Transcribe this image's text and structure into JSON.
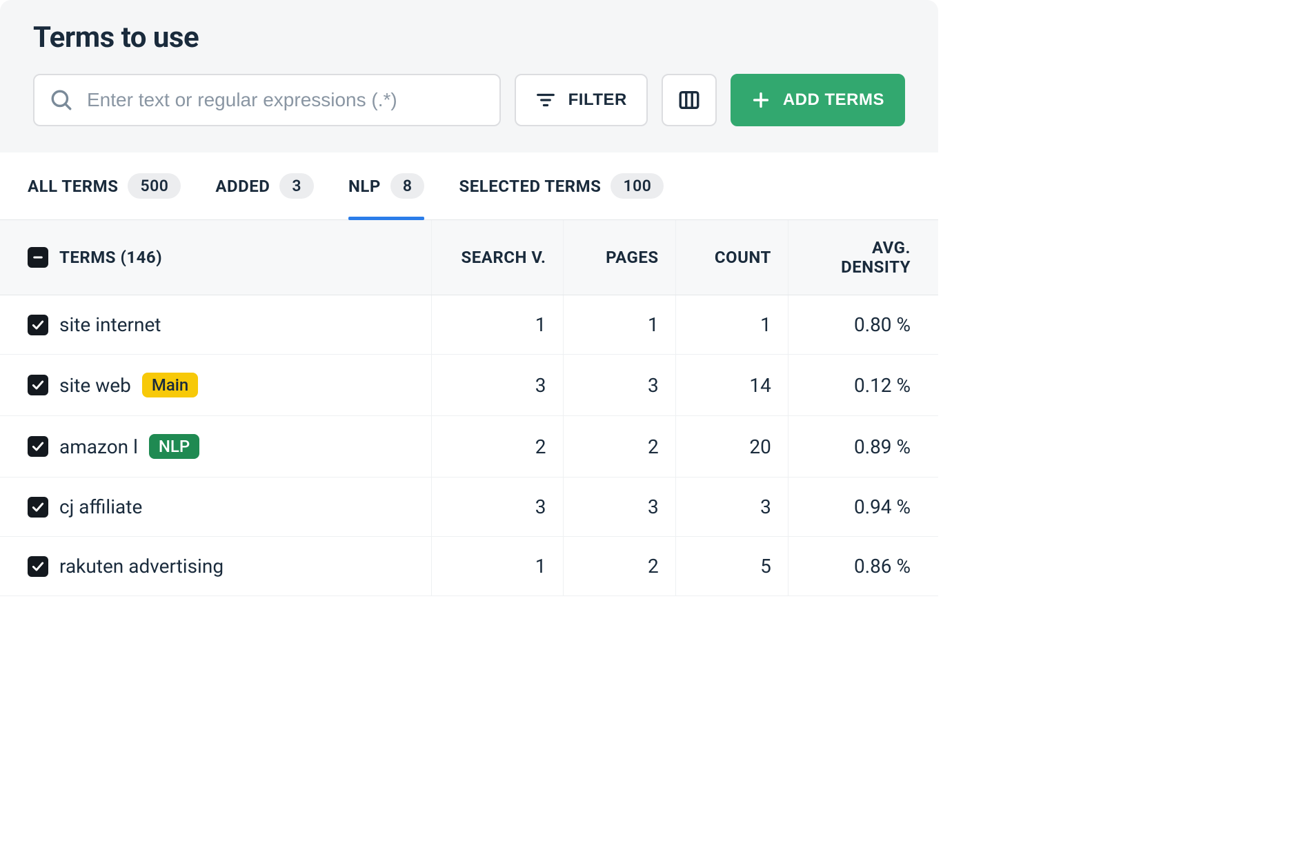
{
  "header": {
    "title": "Terms to use",
    "search_placeholder": "Enter text or regular expressions (.*)",
    "filter_label": "FILTER",
    "add_terms_label": "ADD TERMS"
  },
  "tabs": {
    "all_terms": {
      "label": "ALL TERMS",
      "count": "500"
    },
    "added": {
      "label": "ADDED",
      "count": "3"
    },
    "nlp": {
      "label": "NLP",
      "count": "8"
    },
    "selected": {
      "label": "SELECTED TERMS",
      "count": "100"
    }
  },
  "columns": {
    "terms": "TERMS (146)",
    "search_v": "SEARCH V.",
    "pages": "PAGES",
    "count": "COUNT",
    "avg_density": "AVG. DENSITY"
  },
  "tags": {
    "main": "Main",
    "nlp": "NLP"
  },
  "rows": [
    {
      "term": "site internet",
      "tag": null,
      "search_v": "1",
      "pages": "1",
      "count": "1",
      "density": "0.80 %"
    },
    {
      "term": "site web",
      "tag": "main",
      "search_v": "3",
      "pages": "3",
      "count": "14",
      "density": "0.12 %"
    },
    {
      "term": "amazon l",
      "tag": "nlp",
      "search_v": "2",
      "pages": "2",
      "count": "20",
      "density": "0.89 %"
    },
    {
      "term": "cj affiliate",
      "tag": null,
      "search_v": "3",
      "pages": "3",
      "count": "3",
      "density": "0.94 %"
    },
    {
      "term": "rakuten advertising",
      "tag": null,
      "search_v": "1",
      "pages": "2",
      "count": "5",
      "density": "0.86 %"
    }
  ]
}
